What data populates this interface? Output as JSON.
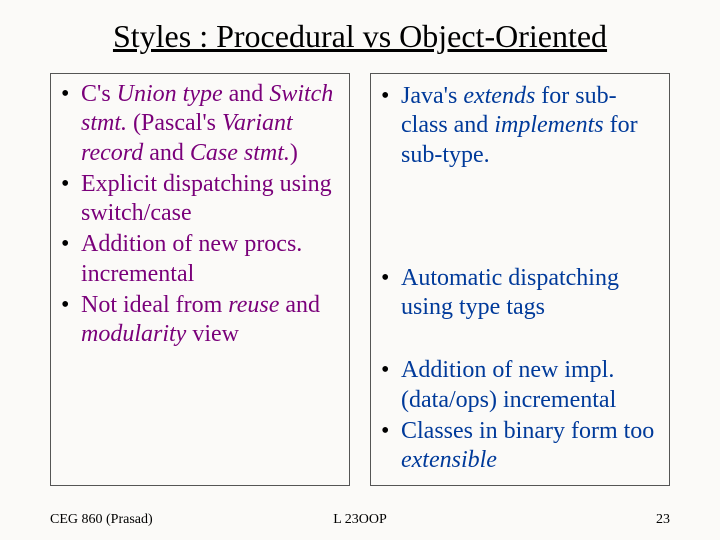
{
  "title": "Styles : Procedural vs Object-Oriented",
  "left": {
    "b1": "C's <em>Union type</em> and <em>Switch stmt.</em> (Pascal's <em>Variant record</em> and <em>Case stmt.</em>)",
    "b2": "Explicit dispatching using switch/case",
    "b3": "Addition of new procs. incremental",
    "b4": "Not ideal from <em>reuse</em> and <em>modularity</em> view"
  },
  "right": {
    "b1": "Java's <em>extends</em> for sub-class and <em>implements</em> for sub-type.",
    "b2": "Automatic dispatching using type tags",
    "b3": "Addition of new impl. (data/ops) incremental",
    "b4": "Classes in binary form too <em>extensible</em>"
  },
  "footer": {
    "left": "CEG 860  (Prasad)",
    "center": "L 23OOP",
    "right": "23"
  }
}
